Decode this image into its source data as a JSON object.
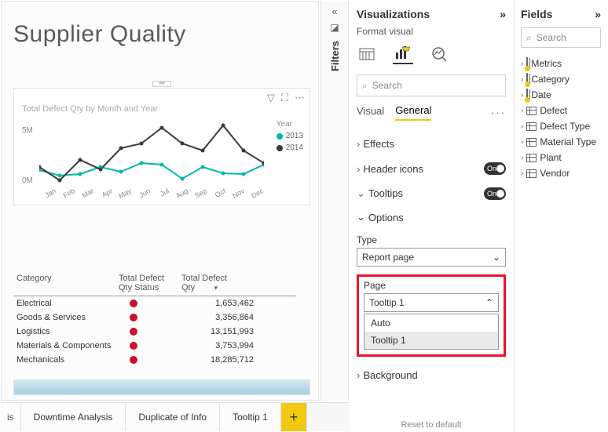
{
  "report": {
    "title": "Supplier Quality"
  },
  "chart_data": {
    "type": "line",
    "title": "Total Defect Qty by Month and Year",
    "legend_title": "Year",
    "xlabel": "",
    "ylabel": "",
    "categories": [
      "Jan",
      "Feb",
      "Mar",
      "Apr",
      "May",
      "Jun",
      "Jul",
      "Aug",
      "Sep",
      "Oct",
      "Nov",
      "Dec"
    ],
    "series": [
      {
        "name": "2013",
        "color": "#00b8a9",
        "values": [
          1.5,
          1.0,
          1.2,
          1.8,
          1.4,
          2.2,
          2.0,
          0.8,
          1.8,
          1.3,
          1.2,
          2.0
        ]
      },
      {
        "name": "2014",
        "color": "#3a3a3a",
        "values": [
          1.8,
          0.6,
          2.4,
          1.6,
          3.4,
          3.8,
          5.2,
          3.8,
          3.2,
          5.4,
          3.2,
          2.2
        ]
      }
    ],
    "yticks": [
      "0M",
      "5M"
    ],
    "ylim": [
      0,
      6
    ]
  },
  "table": {
    "columns": {
      "c1": "Category",
      "c2a": "Total Defect",
      "c2b": "Qty Status",
      "c3a": "Total Defect",
      "c3b": "Qty"
    },
    "rows": [
      {
        "category": "Electrical",
        "status": "red",
        "qty": "1,653,462"
      },
      {
        "category": "Goods & Services",
        "status": "red",
        "qty": "3,356,864"
      },
      {
        "category": "Logistics",
        "status": "red",
        "qty": "13,151,993"
      },
      {
        "category": "Materials & Components",
        "status": "red",
        "qty": "3,753,994"
      },
      {
        "category": "Mechanicals",
        "status": "red",
        "qty": "18,285,712"
      }
    ]
  },
  "page_tabs": {
    "t0": "is",
    "t1": "Downtime Analysis",
    "t2": "Duplicate of Info",
    "t3": "Tooltip 1",
    "add": "+"
  },
  "filters_rail": {
    "label": "Filters"
  },
  "viz": {
    "title": "Visualizations",
    "format_label": "Format visual",
    "search_placeholder": "Search",
    "sub_visual": "Visual",
    "sub_general": "General",
    "effects": "Effects",
    "header_icons": "Header icons",
    "tooltips": "Tooltips",
    "options": "Options",
    "type_label": "Type",
    "type_value": "Report page",
    "page_label": "Page",
    "page_value": "Tooltip 1",
    "dd_auto": "Auto",
    "dd_tooltip1": "Tooltip 1",
    "background": "Background",
    "reset": "Reset to default",
    "toggle_on": "On"
  },
  "fields": {
    "title": "Fields",
    "search_placeholder": "Search",
    "items": [
      {
        "name": "Metrics",
        "badged": true
      },
      {
        "name": "Category",
        "badged": true
      },
      {
        "name": "Date",
        "badged": true
      },
      {
        "name": "Defect",
        "badged": false
      },
      {
        "name": "Defect Type",
        "badged": false
      },
      {
        "name": "Material Type",
        "badged": false
      },
      {
        "name": "Plant",
        "badged": false
      },
      {
        "name": "Vendor",
        "badged": false
      }
    ]
  }
}
